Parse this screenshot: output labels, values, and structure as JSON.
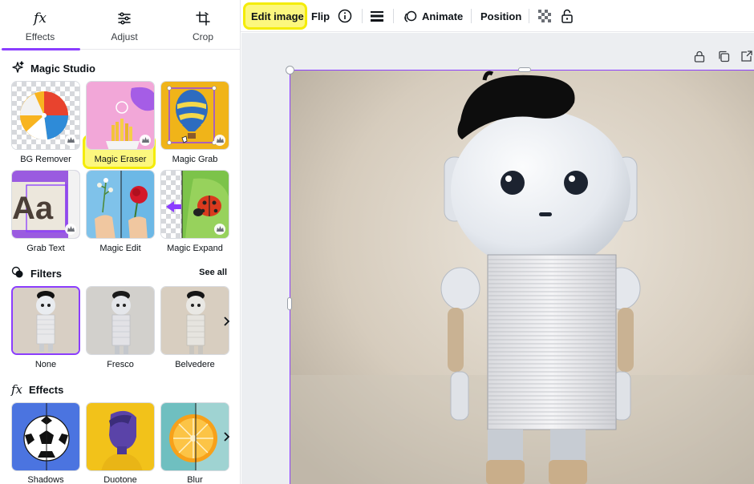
{
  "panel": {
    "tabs": [
      {
        "label": "Effects",
        "icon": "fx-icon",
        "active": true
      },
      {
        "label": "Adjust",
        "icon": "sliders-icon"
      },
      {
        "label": "Crop",
        "icon": "crop-icon"
      }
    ],
    "magic_studio": {
      "title": "Magic Studio",
      "icon": "sparkle-icon",
      "tools": [
        {
          "label": "BG Remover",
          "icon": "beach-ball-icon",
          "pro": true
        },
        {
          "label": "Magic Eraser",
          "icon": "fries-icon",
          "pro": true,
          "highlighted": true
        },
        {
          "label": "Magic Grab",
          "icon": "hot-air-balloon-icon",
          "pro": true
        },
        {
          "label": "Grab Text",
          "icon": "text-aa-icon",
          "pro": true
        },
        {
          "label": "Magic Edit",
          "icon": "flower-hand-icon",
          "pro": false
        },
        {
          "label": "Magic Expand",
          "icon": "ladybug-icon",
          "pro": true
        }
      ]
    },
    "filters": {
      "title": "Filters",
      "icon": "filters-icon",
      "see_all": "See all",
      "items": [
        {
          "label": "None",
          "selected": true
        },
        {
          "label": "Fresco"
        },
        {
          "label": "Belvedere"
        }
      ]
    },
    "effects": {
      "title": "Effects",
      "icon": "fx-icon",
      "items": [
        {
          "label": "Shadows",
          "icon": "soccer-ball-icon"
        },
        {
          "label": "Duotone",
          "icon": "portrait-icon"
        },
        {
          "label": "Blur",
          "icon": "orange-slice-icon"
        }
      ]
    }
  },
  "toolbar": {
    "edit_image": "Edit image",
    "flip": "Flip",
    "animate": "Animate",
    "position": "Position"
  },
  "colors": {
    "accent": "#8b3dff",
    "highlight": "#f4ec08"
  }
}
